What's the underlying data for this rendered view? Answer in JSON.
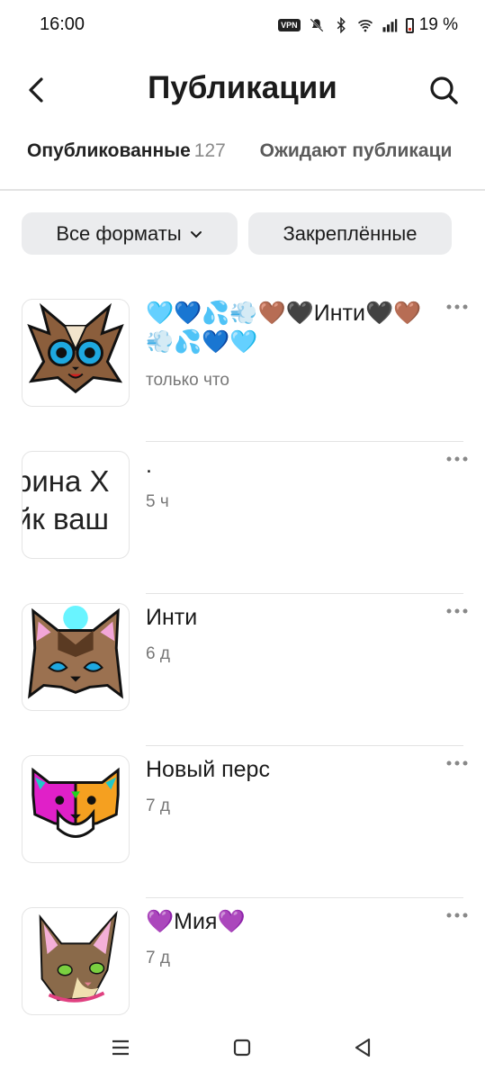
{
  "status_bar": {
    "time": "16:00",
    "vpn": "VPN",
    "battery": "19 %"
  },
  "header": {
    "title": "Публикации"
  },
  "tabs": [
    {
      "label": "Опубликованные",
      "count": "127"
    },
    {
      "label": "Ожидают публикаци"
    }
  ],
  "filters": {
    "formats": "Все форматы",
    "pinned": "Закреплённые"
  },
  "posts": [
    {
      "title": "🩵💙💦💨🤎🖤Инти🖤🤎💨💦💙🩵",
      "time": "только что",
      "thumb": "brown-cat-icon"
    },
    {
      "title": ".",
      "time": "5 ч",
      "thumb": "text-thumbnail",
      "thumb_line1": "рина Х",
      "thumb_line2": "йк ваш"
    },
    {
      "title": "Инти",
      "time": "6 д",
      "thumb": "brown-cat-icon"
    },
    {
      "title": "Новый перс",
      "time": "7 д",
      "thumb": "colorful-cat-icon"
    },
    {
      "title": "💜Мия💜",
      "time": "7 д",
      "thumb": "tabby-cat-icon"
    }
  ],
  "colors": {
    "accent": "#1b1b1b",
    "chip_bg": "#ebecee",
    "muted": "#777777"
  }
}
